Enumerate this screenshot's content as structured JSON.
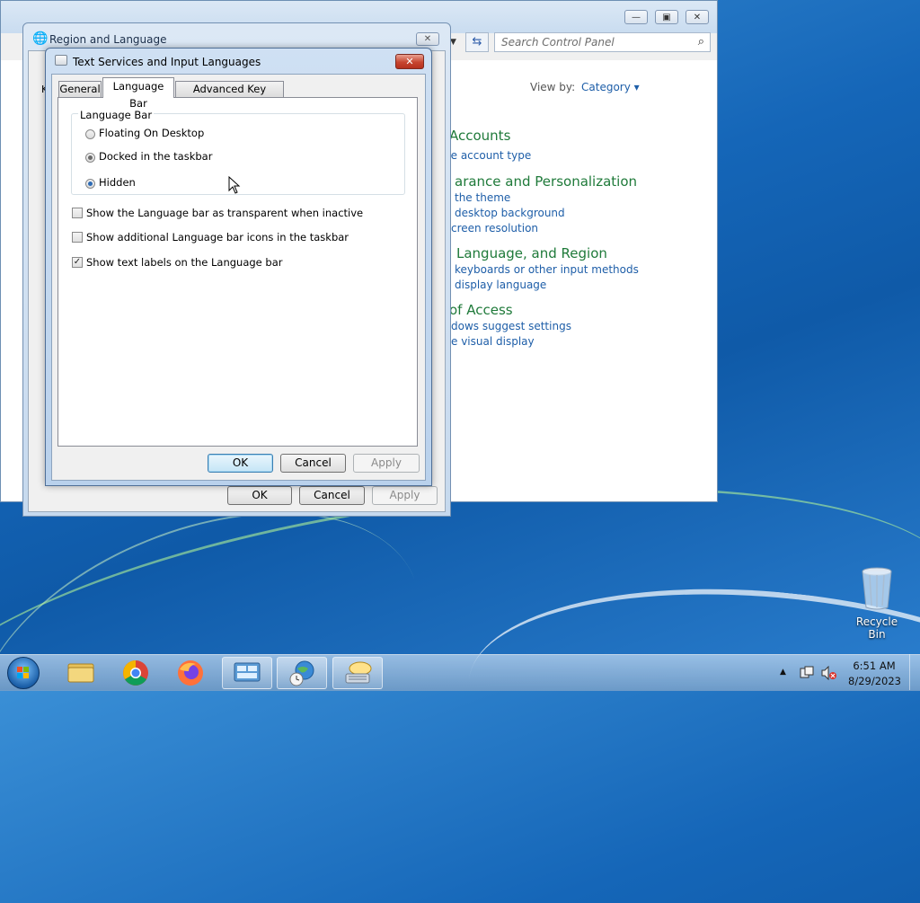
{
  "desktop": {
    "recycle_bin_label": "Recycle Bin"
  },
  "control_panel": {
    "search_placeholder": "Search Control Panel",
    "view_by_label": "View by:",
    "view_by_value": "Category",
    "categories": [
      {
        "heading": "Accounts",
        "links": [
          "ge account type"
        ]
      },
      {
        "heading": "arance and Personalization",
        "links": [
          "the theme",
          "desktop background",
          "creen resolution"
        ]
      },
      {
        "heading": "Language, and Region",
        "links": [
          "keyboards or other input methods",
          "display language"
        ]
      },
      {
        "heading": "of Access",
        "links": [
          "dows suggest settings",
          "e visual display"
        ]
      }
    ]
  },
  "region_dialog": {
    "title": "Region and Language",
    "partial_tab": "K",
    "ok_label": "OK",
    "cancel_label": "Cancel",
    "apply_label": "Apply"
  },
  "text_services_dialog": {
    "title": "Text Services and Input Languages",
    "tabs": [
      "General",
      "Language Bar",
      "Advanced Key Settings"
    ],
    "active_tab": "Language Bar",
    "group_label": "Language Bar",
    "radio_options": [
      {
        "label": "Floating On Desktop",
        "selected": false
      },
      {
        "label": "Docked in the taskbar",
        "selected": false
      },
      {
        "label": "Hidden",
        "selected": true
      }
    ],
    "checkboxes": [
      {
        "label": "Show the Language bar as transparent when inactive",
        "checked": false
      },
      {
        "label": "Show additional Language bar icons in the taskbar",
        "checked": false
      },
      {
        "label": "Show text labels on the Language bar",
        "checked": true
      }
    ],
    "ok_label": "OK",
    "cancel_label": "Cancel",
    "apply_label": "Apply"
  },
  "taskbar": {
    "time": "6:51 AM",
    "date": "8/29/2023"
  }
}
